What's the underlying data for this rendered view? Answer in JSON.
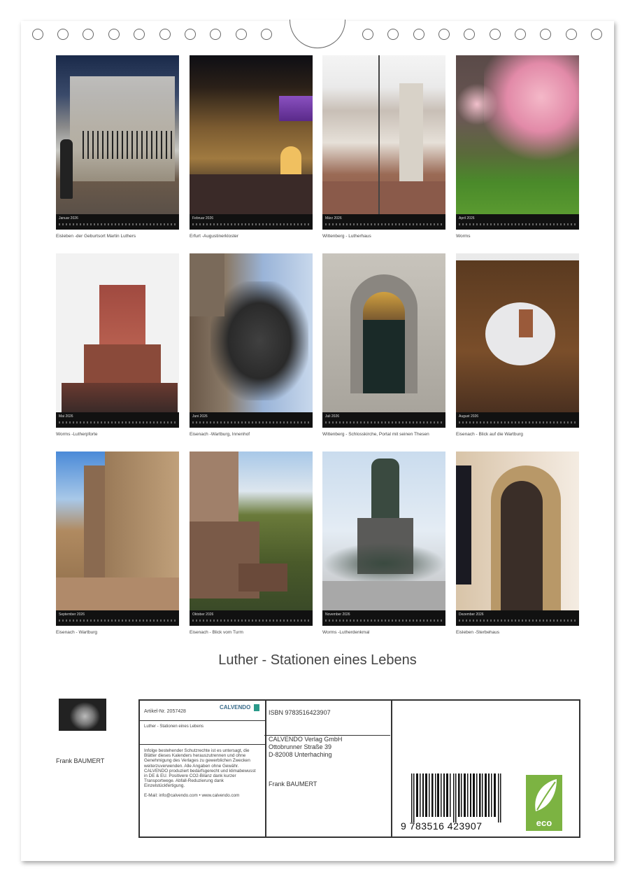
{
  "months": [
    {
      "month": "Januar 2026",
      "caption": "Eisleben -der Geburtsort Martin Luthers"
    },
    {
      "month": "Februar 2026",
      "caption": "Erfurt -Augustinerkloster"
    },
    {
      "month": "März 2026",
      "caption": "Wittenberg - Lutherhaus"
    },
    {
      "month": "April 2026",
      "caption": "Worms"
    },
    {
      "month": "Mai 2026",
      "caption": "Worms -Lutherpforte"
    },
    {
      "month": "Juni 2026",
      "caption": "Eisenach -Wartburg, Innenhof"
    },
    {
      "month": "Juli 2026",
      "caption": "Wittenberg - Schlosskirche, Portal mit seinen Thesen"
    },
    {
      "month": "August 2026",
      "caption": "Eisenach - Blick auf die Wartburg"
    },
    {
      "month": "September 2026",
      "caption": "Eisenach - Wartburg"
    },
    {
      "month": "Oktober 2026",
      "caption": "Eisenach - Blick vom Turm"
    },
    {
      "month": "November 2026",
      "caption": "Worms -Lutherdenkmal"
    },
    {
      "month": "Dezember 2026",
      "caption": "Eisleben -Sterbehaus"
    }
  ],
  "calendar_title": "Luther - Stationen eines Lebens",
  "author": "Frank BAUMERT",
  "info": {
    "article": "Artikel-Nr. 2057428",
    "logo": "CALVENDO",
    "title_small": "Luther - Stationen eines Lebens",
    "legal": "Infolge bestehender Schutzrechte ist es untersagt, die Blätter dieses Kalenders herauszutrennen und ohne Genehmigung des Verlages zu gewerblichen Zwecken weiterzuverwenden. Alle Angaben ohne Gewähr. CALVENDO produziert bedarfsgerecht und klimabewusst in DE & EU. Positivere CO2-Bilanz dank kurzer Transportwege. Abfall-Reduzierung dank Einzelstückfertigung.",
    "email": "E-Mail: info@calvendo.com • www.calvendo.com",
    "isbn": "ISBN 9783516423907",
    "publisher_1": "CALVENDO Verlag GmbH",
    "publisher_2": "Ottobrunner Straße 39",
    "publisher_3": "D-82008 Unterhaching",
    "author_small": "Frank BAUMERT",
    "barcode_number": "9 783516 423907",
    "eco_label": "eco"
  }
}
